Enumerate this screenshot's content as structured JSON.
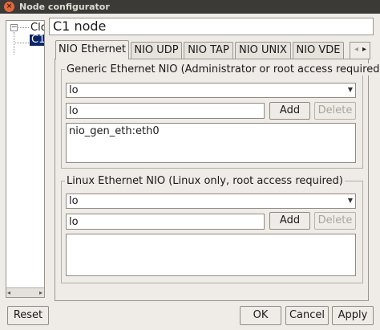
{
  "window": {
    "title": "Node configurator",
    "close_glyph": "×"
  },
  "tree": {
    "expander": "−",
    "root_label": "Clo",
    "child_label": "C1",
    "scroll_left": "◂",
    "scroll_right": "▸"
  },
  "node": {
    "title": "C1 node"
  },
  "tabs": [
    {
      "label": "NIO Ethernet",
      "active": true
    },
    {
      "label": "NIO UDP"
    },
    {
      "label": "NIO TAP"
    },
    {
      "label": "NIO UNIX"
    },
    {
      "label": "NIO VDE"
    }
  ],
  "tab_scroll": {
    "left": "◂",
    "right": "▸"
  },
  "generic": {
    "title": "Generic Ethernet NIO (Administrator or root access required)",
    "combo_value": "lo",
    "input_value": "lo",
    "add_label": "Add",
    "delete_label": "Delete",
    "list_items": [
      "nio_gen_eth:eth0"
    ]
  },
  "linux": {
    "title": "Linux Ethernet NIO (Linux only, root access required)",
    "combo_value": "lo",
    "input_value": "lo",
    "add_label": "Add",
    "delete_label": "Delete",
    "list_items": []
  },
  "footer": {
    "reset_label": "Reset",
    "ok_label": "OK",
    "cancel_label": "Cancel",
    "apply_label": "Apply"
  },
  "icons": {
    "combo_arrow": "▼"
  }
}
